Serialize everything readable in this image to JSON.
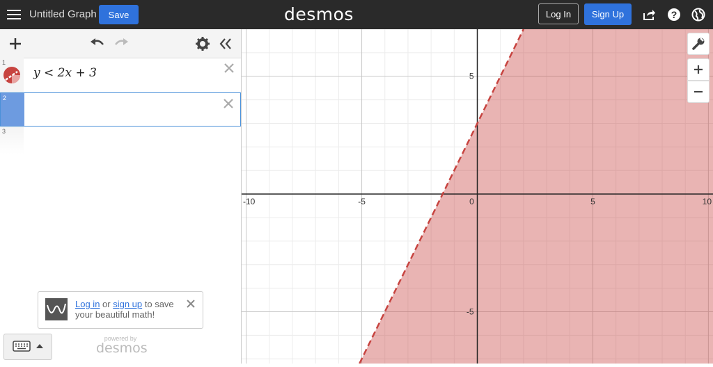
{
  "topbar": {
    "title": "Untitled Graph",
    "save_label": "Save",
    "logo": "desmos",
    "login_label": "Log In",
    "signup_label": "Sign Up",
    "icons": [
      "menu-icon",
      "share-icon",
      "help-icon",
      "globe-icon"
    ]
  },
  "expressions": [
    {
      "number": "1",
      "latex_display": "y < 2x + 3",
      "color": "#c74440"
    },
    {
      "number": "2",
      "latex_display": ""
    },
    {
      "number": "3",
      "latex_display": ""
    }
  ],
  "promo": {
    "login_link": "Log in",
    "or": " or ",
    "signup_link": "sign up",
    "rest": " to save your beautiful math!"
  },
  "powered": {
    "by": "powered by",
    "logo": "desmos"
  },
  "graph": {
    "xlim": [
      -10.2,
      10.2
    ],
    "ylim": [
      -7.2,
      7.0
    ],
    "x_ticks": [
      -10,
      -5,
      0,
      5,
      10
    ],
    "y_ticks": [
      -5,
      5
    ],
    "inequality": {
      "slope": 2,
      "intercept": 3,
      "direction": "below",
      "boundary": "dashed"
    },
    "fill_color": "#c74440"
  },
  "colors": {
    "accent": "#2f72dc",
    "topbar_bg": "#2a2a2a",
    "curve": "#c74440"
  }
}
